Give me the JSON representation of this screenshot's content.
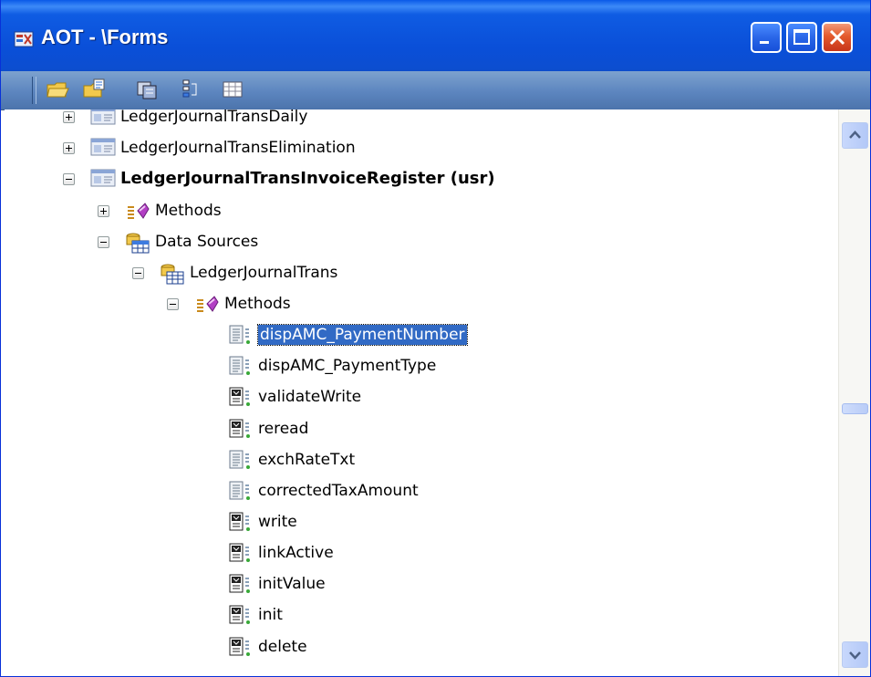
{
  "window": {
    "title": "AOT - \\Forms"
  },
  "toolbar": {
    "buttons": [
      "open-icon",
      "properties-icon",
      "compile-icon",
      "import-icon",
      "grid-icon"
    ]
  },
  "tree": {
    "items": [
      {
        "label": "LedgerJournalTransDaily",
        "icon": "form-icon",
        "expander": "plus"
      },
      {
        "label": "LedgerJournalTransElimination",
        "icon": "form-icon",
        "expander": "plus"
      },
      {
        "label": "LedgerJournalTransInvoiceRegister (usr)",
        "icon": "form-icon",
        "expander": "minus"
      },
      {
        "label": "Methods",
        "icon": "methods-icon",
        "expander": "plus"
      },
      {
        "label": "Data Sources",
        "icon": "datasources-icon",
        "expander": "minus"
      },
      {
        "label": "LedgerJournalTrans",
        "icon": "datasource-icon",
        "expander": "minus"
      },
      {
        "label": "Methods",
        "icon": "methods-icon",
        "expander": "minus"
      },
      {
        "label": "dispAMC_PaymentNumber",
        "icon": "method-icon"
      },
      {
        "label": "dispAMC_PaymentType",
        "icon": "method-icon"
      },
      {
        "label": "validateWrite",
        "icon": "override-method-icon"
      },
      {
        "label": "reread",
        "icon": "override-method-icon"
      },
      {
        "label": "exchRateTxt",
        "icon": "method-icon"
      },
      {
        "label": "correctedTaxAmount",
        "icon": "method-icon"
      },
      {
        "label": "write",
        "icon": "override-method-icon"
      },
      {
        "label": "linkActive",
        "icon": "override-method-icon"
      },
      {
        "label": "initValue",
        "icon": "override-method-icon"
      },
      {
        "label": "init",
        "icon": "override-method-icon"
      },
      {
        "label": "delete",
        "icon": "override-method-icon"
      }
    ],
    "selected": "dispAMC_PaymentNumber"
  },
  "colors": {
    "selection": "#316ac5",
    "titlebar": "#0a4fd8"
  }
}
